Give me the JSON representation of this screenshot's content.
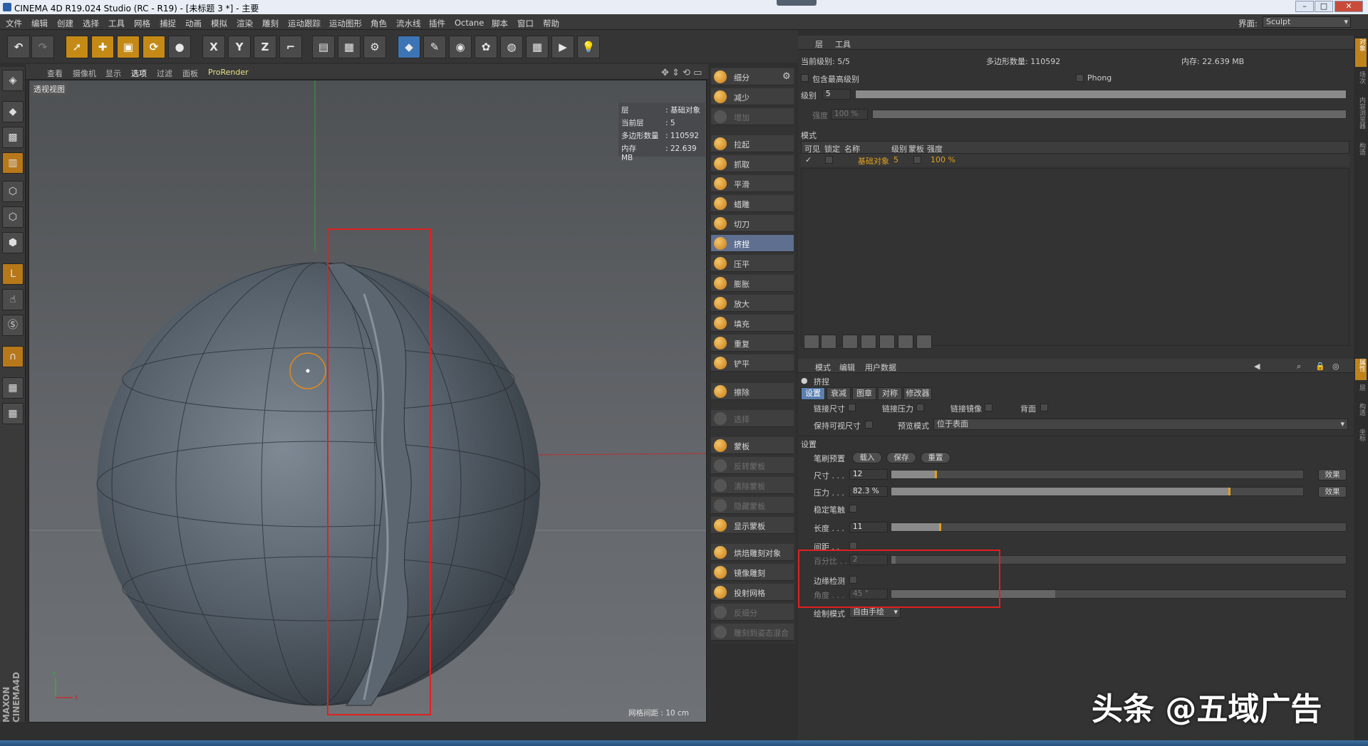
{
  "titlebar": {
    "title": "CINEMA 4D R19.024 Studio (RC - R19) - [未标题 3 *] - 主要",
    "layout_label": "界面:",
    "layout_value": "Sculpt"
  },
  "menu": [
    "文件",
    "编辑",
    "创建",
    "选择",
    "工具",
    "网格",
    "捕捉",
    "动画",
    "模拟",
    "渲染",
    "雕刻",
    "运动跟踪",
    "运动图形",
    "角色",
    "流水线",
    "插件",
    "Octane",
    "脚本",
    "窗口",
    "帮助"
  ],
  "toolbar": {
    "x": "X",
    "y": "Y",
    "z": "Z"
  },
  "viewport": {
    "menu": [
      "查看",
      "摄像机",
      "显示",
      "选项",
      "过滤",
      "面板",
      "ProRender"
    ],
    "label": "透视视图",
    "hud": [
      {
        "k": "层",
        "v": ": 基础对象"
      },
      {
        "k": "当前层",
        "v": ": 5"
      },
      {
        "k": "多边形数量",
        "v": ": 110592"
      },
      {
        "k": "内存",
        "v": ": 22.639 MB"
      }
    ],
    "grid": "网格间距 : 10 cm",
    "axis_y": "Y",
    "axis_x": "X",
    "brand": "MAXON CINEMA4D"
  },
  "sculpt_tools": [
    {
      "label": "细分",
      "state": "normal"
    },
    {
      "label": "减少",
      "state": "normal"
    },
    {
      "label": "增加",
      "state": "disabled"
    },
    {
      "label": "拉起",
      "state": "normal"
    },
    {
      "label": "抓取",
      "state": "normal"
    },
    {
      "label": "平滑",
      "state": "normal"
    },
    {
      "label": "蜡雕",
      "state": "normal"
    },
    {
      "label": "切刀",
      "state": "normal"
    },
    {
      "label": "挤捏",
      "state": "selected"
    },
    {
      "label": "压平",
      "state": "normal"
    },
    {
      "label": "膨胀",
      "state": "normal"
    },
    {
      "label": "放大",
      "state": "normal"
    },
    {
      "label": "填充",
      "state": "normal"
    },
    {
      "label": "重复",
      "state": "normal"
    },
    {
      "label": "铲平",
      "state": "normal"
    },
    {
      "label": "擦除",
      "state": "normal"
    },
    {
      "label": "选择",
      "state": "disabled"
    },
    {
      "label": "蒙板",
      "state": "normal"
    },
    {
      "label": "反转蒙板",
      "state": "disabled"
    },
    {
      "label": "清除蒙板",
      "state": "disabled"
    },
    {
      "label": "隐藏蒙板",
      "state": "disabled"
    },
    {
      "label": "显示蒙板",
      "state": "normal"
    },
    {
      "label": "烘焙雕刻对象",
      "state": "normal"
    },
    {
      "label": "镜像雕刻",
      "state": "normal"
    },
    {
      "label": "投射网格",
      "state": "normal"
    },
    {
      "label": "反细分",
      "state": "disabled"
    },
    {
      "label": "雕刻到姿态混合",
      "state": "disabled"
    }
  ],
  "layers": {
    "header": [
      "层",
      "工具"
    ],
    "current_level": "当前级别: 5/5",
    "poly_count": "多边形数量: 110592",
    "memory": "内存: 22.639 MB",
    "include_top": "包含最高级别",
    "phong": "Phong",
    "level_label": "级别",
    "level_value": "5",
    "strength_label": "强度",
    "strength_value": "100 %",
    "mode_label": "模式",
    "columns": [
      "可见",
      "锁定",
      "名称",
      "级别",
      "蒙板",
      "强度"
    ],
    "row": {
      "name": "基础对象",
      "level": "5",
      "strength": "100 %"
    }
  },
  "attributes": {
    "header": [
      "模式",
      "编辑",
      "用户数据"
    ],
    "tool_name": "挤捏",
    "tabs": [
      "设置",
      "衰减",
      "图章",
      "对称",
      "修改器"
    ],
    "link_size": "链接尺寸",
    "link_pressure": "链接压力",
    "link_mirror": "链接镜像",
    "backface": "背面",
    "keep_visible": "保持可视尺寸",
    "preview_mode_label": "预览模式",
    "preview_mode_value": "位于表面",
    "section": "设置",
    "brush_preset": "笔刷预置",
    "load": "载入",
    "save": "保存",
    "reset": "重置",
    "size_label": "尺寸 . . .",
    "size_value": "12",
    "size_frac": 0.11,
    "pressure_label": "压力 . . .",
    "pressure_value": "82.3 %",
    "pressure_frac": 0.823,
    "effect": "效果",
    "stabilize": "稳定笔触",
    "length_label": "长度 . . .",
    "length_value": "11",
    "length_frac": 0.11,
    "spacing": "间距 . .",
    "percent_label": "百分比 . . .",
    "percent_value": "2",
    "edge_detect": "边缘检测",
    "angle_label": "角度 . . .",
    "angle_value": "45 °",
    "draw_mode_label": "绘制模式",
    "draw_mode_value": "自由手绘"
  },
  "side_tabs": [
    "属性",
    "层",
    "构造",
    "坐标"
  ],
  "side_tabs_top": [
    "对象",
    "场次",
    "内容浏览器",
    "构造"
  ],
  "watermark": "头条 @五域广告"
}
